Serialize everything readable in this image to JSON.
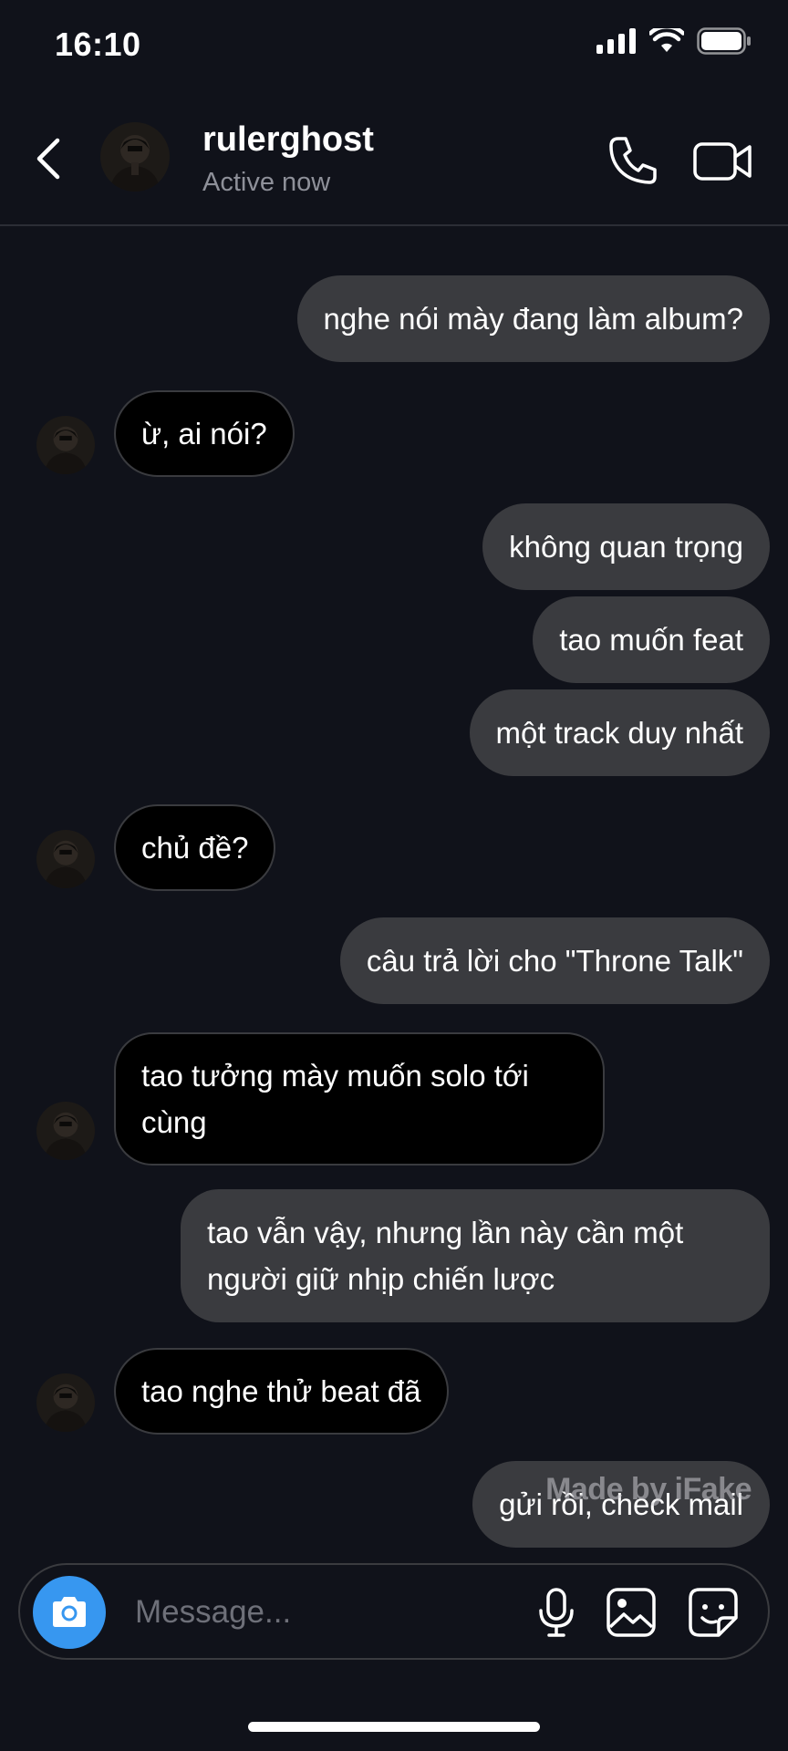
{
  "status_bar": {
    "time": "16:10"
  },
  "header": {
    "username": "rulerghost",
    "status": "Active now"
  },
  "messages": [
    {
      "dir": "out",
      "text": "nghe nói mày đang làm album?"
    },
    {
      "dir": "in",
      "text": "ừ, ai nói?"
    },
    {
      "dir": "out",
      "text": "không quan trọng"
    },
    {
      "dir": "out",
      "text": "tao muốn feat"
    },
    {
      "dir": "out",
      "text": "một track duy nhất"
    },
    {
      "dir": "in",
      "text": "chủ đề?"
    },
    {
      "dir": "out",
      "text": "câu trả lời cho \"Throne Talk\""
    },
    {
      "dir": "in",
      "text": "tao tưởng mày muốn solo tới cùng"
    },
    {
      "dir": "out",
      "text": "tao vẫn vậy, nhưng lần này cần một người giữ nhịp chiến lược"
    },
    {
      "dir": "in",
      "text": "tao nghe thử beat đã"
    },
    {
      "dir": "out",
      "text": "gửi rồi, check mail"
    }
  ],
  "watermark": "Made by iFake",
  "composer": {
    "placeholder": "Message..."
  },
  "colors": {
    "accent": "#3797f0",
    "background": "#10121a",
    "outgoing_bubble": "#3a3b3f",
    "incoming_bubble": "#000000"
  },
  "icons": [
    "back-chevron-icon",
    "phone-icon",
    "video-camera-icon",
    "camera-icon",
    "microphone-icon",
    "image-icon",
    "sticker-icon",
    "signal-icon",
    "wifi-icon",
    "battery-icon"
  ]
}
